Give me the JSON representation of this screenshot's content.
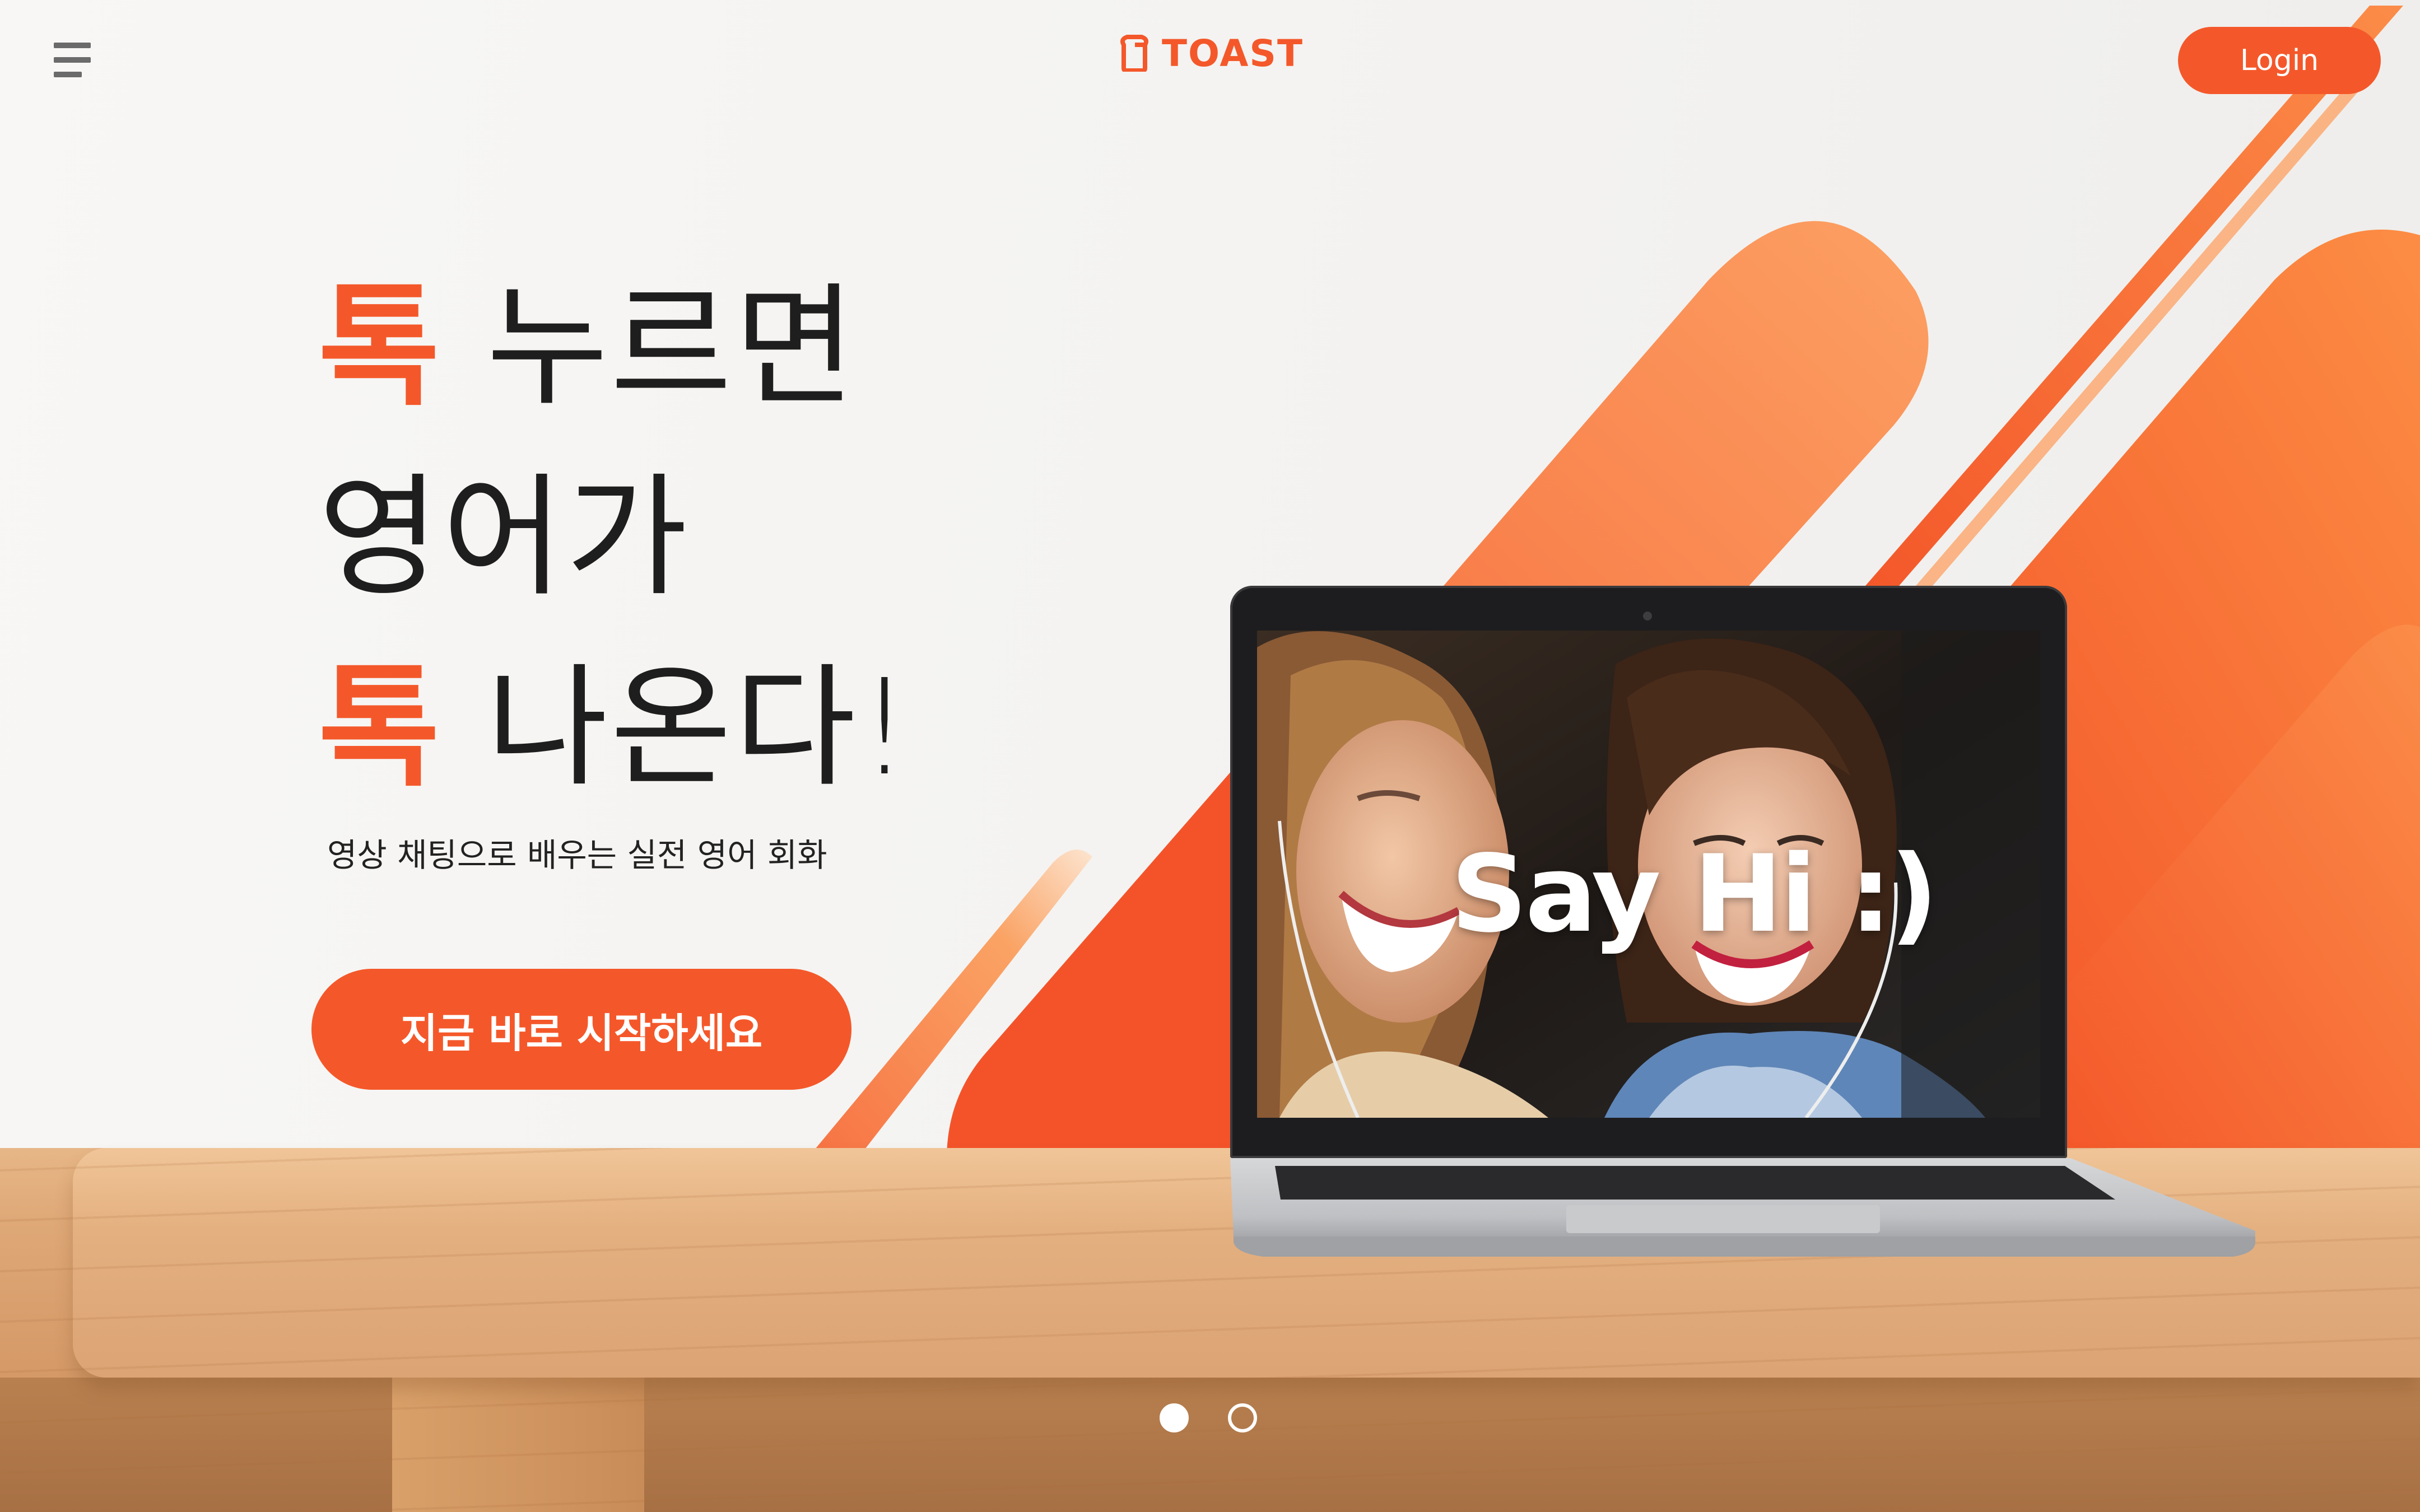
{
  "header": {
    "menu_icon": "hamburger-menu-icon",
    "logo_icon": "toast-bread-icon",
    "logo_text": "TOAST",
    "login_label": "Login"
  },
  "hero": {
    "line1_accent": "톡",
    "line1_rest": "누르면",
    "line2": "영어가",
    "line3_accent": "톡",
    "line3_rest": "나온다!",
    "subtitle": "영상 채팅으로 배우는 실전 영어 회화",
    "cta_label": "지금 바로 시작하세요"
  },
  "laptop_screen": {
    "overlay_text": "Say Hi :)"
  },
  "pagination": {
    "active_index": 0,
    "count": 2
  },
  "colors": {
    "accent": "#f4582a",
    "accent_light": "#fb8a4c",
    "text_dark": "#1e1e1e",
    "wall": "#f6f5f3"
  }
}
